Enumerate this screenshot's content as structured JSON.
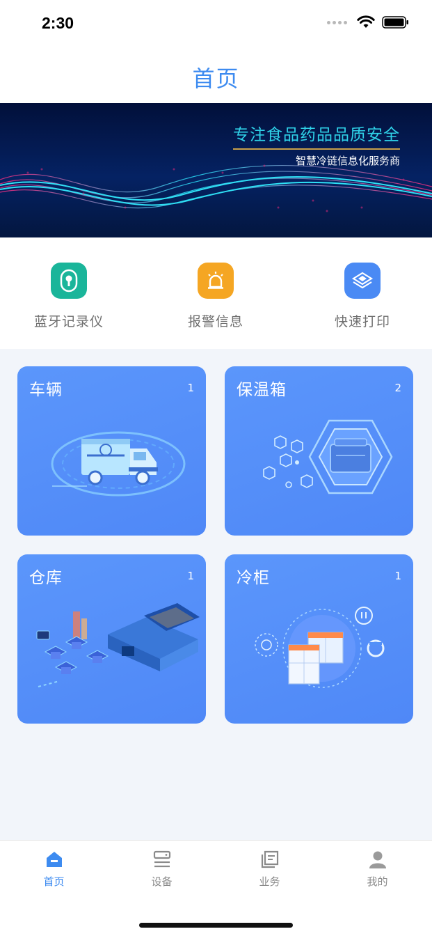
{
  "status_bar": {
    "time": "2:30"
  },
  "header": {
    "title": "首页"
  },
  "banner": {
    "headline": "专注食品药品品质安全",
    "subline": "智慧冷链信息化服务商"
  },
  "quick_actions": [
    {
      "label": "蓝牙记录仪",
      "icon": "bluetooth-logger-icon",
      "color": "#1ab59a"
    },
    {
      "label": "报警信息",
      "icon": "alarm-icon",
      "color": "#f5a623"
    },
    {
      "label": "快速打印",
      "icon": "print-layers-icon",
      "color": "#4a8af4"
    }
  ],
  "cards": [
    {
      "title": "车辆",
      "count": "1",
      "icon": "truck-illustration"
    },
    {
      "title": "保温箱",
      "count": "2",
      "icon": "insulated-box-illustration"
    },
    {
      "title": "仓库",
      "count": "1",
      "icon": "warehouse-illustration"
    },
    {
      "title": "冷柜",
      "count": "1",
      "icon": "freezer-illustration"
    }
  ],
  "tabs": [
    {
      "label": "首页",
      "icon": "home-icon",
      "active": true
    },
    {
      "label": "设备",
      "icon": "device-icon",
      "active": false
    },
    {
      "label": "业务",
      "icon": "business-icon",
      "active": false
    },
    {
      "label": "我的",
      "icon": "profile-icon",
      "active": false
    }
  ],
  "colors": {
    "accent": "#3d8bf0",
    "card": "#5290f8",
    "background": "#f2f5fa"
  }
}
